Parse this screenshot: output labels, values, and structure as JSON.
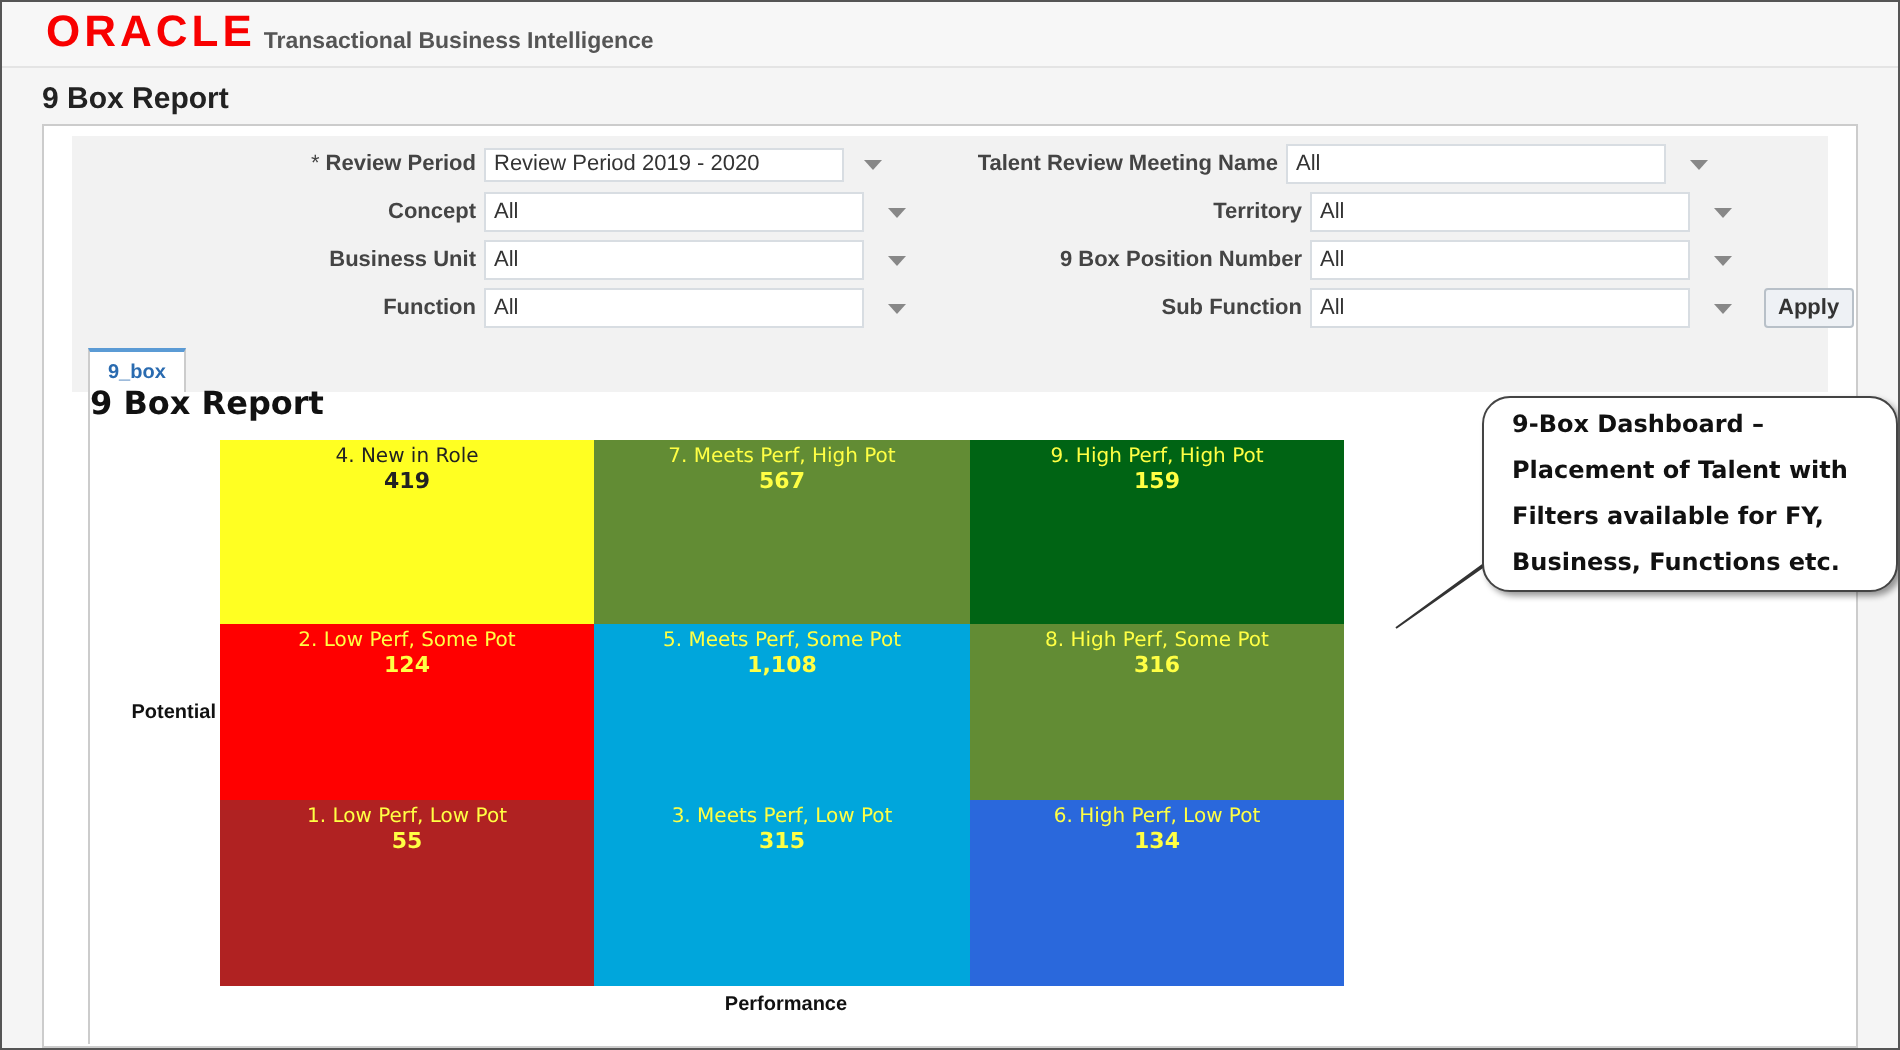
{
  "header": {
    "logo": "ORACLE",
    "product": "Transactional Business Intelligence"
  },
  "page_title": "9 Box Report",
  "filters": [
    {
      "label": "Review Period",
      "required_mark": "*",
      "value": "Review Period 2019 - 2020"
    },
    {
      "label": "Talent Review Meeting Name",
      "value": "All"
    },
    {
      "label": "Concept",
      "value": "All"
    },
    {
      "label": "Territory",
      "value": "All"
    },
    {
      "label": "Business Unit",
      "value": "All"
    },
    {
      "label": "9 Box Position Number",
      "value": "All"
    },
    {
      "label": "Function",
      "value": "All"
    },
    {
      "label": "Sub Function",
      "value": "All"
    }
  ],
  "apply_button": "Apply",
  "tabs": [
    {
      "label": "9_box",
      "selected": true
    }
  ],
  "report": {
    "title": "9 Box Report",
    "y_axis": "Potential",
    "x_axis": "Performance",
    "cells": [
      {
        "label": "4. New in Role",
        "count": "419",
        "color": "#ffff22",
        "kind": "dark"
      },
      {
        "label": "7. Meets Perf, High Pot",
        "count": "567",
        "color": "#628c34",
        "kind": "light"
      },
      {
        "label": "9. High Perf, High Pot",
        "count": "159",
        "color": "#006414",
        "kind": "light"
      },
      {
        "label": "2. Low Perf, Some Pot",
        "count": "124",
        "color": "#ff0000",
        "kind": "light"
      },
      {
        "label": "5. Meets Perf, Some Pot",
        "count": "1,108",
        "color": "#00a6dc",
        "kind": "light"
      },
      {
        "label": "8. High Perf, Some Pot",
        "count": "316",
        "color": "#628c34",
        "kind": "light"
      },
      {
        "label": "1. Low Perf, Low Pot",
        "count": "55",
        "color": "#b02222",
        "kind": "light"
      },
      {
        "label": "3. Meets Perf, Low Pot",
        "count": "315",
        "color": "#00a6dc",
        "kind": "light"
      },
      {
        "label": "6. High Perf, Low Pot",
        "count": "134",
        "color": "#2a68dc",
        "kind": "light"
      }
    ]
  },
  "callout": "9-Box Dashboard – Placement of Talent with Filters available for FY, Business, Functions etc."
}
